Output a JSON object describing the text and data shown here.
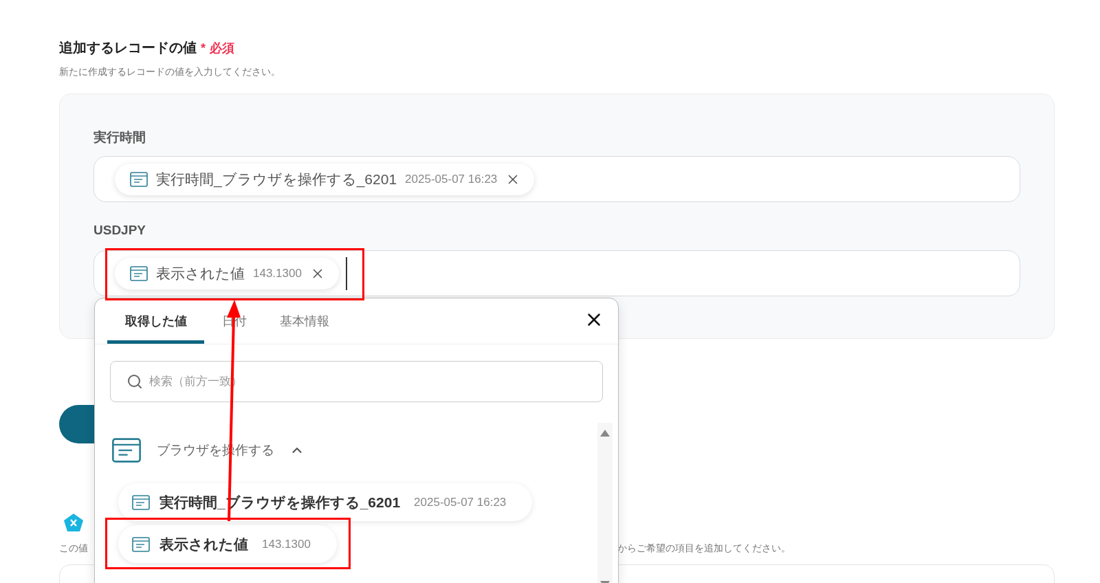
{
  "section": {
    "title": "追加するレコードの値",
    "required_mark": "*",
    "required_label": "必須",
    "description": "新たに作成するレコードの値を入力してください。"
  },
  "fields": [
    {
      "label": "実行時間",
      "chips": [
        {
          "name": "実行時間_ブラウザを操作する_6201",
          "value": "2025-05-07 16:23"
        }
      ]
    },
    {
      "label": "USDJPY",
      "chips": [
        {
          "name": "表示された値",
          "value": "143.1300"
        }
      ],
      "cursor": true
    }
  ],
  "note": {
    "start": "この値",
    "end": "からご希望の項目を追加してください。"
  },
  "popover": {
    "tabs": [
      {
        "label": "取得した値",
        "selected": true
      },
      {
        "label": "日付",
        "selected": false
      },
      {
        "label": "基本情報",
        "selected": false
      }
    ],
    "search": {
      "placeholder": "検索（前方一致）"
    },
    "group": {
      "title": "ブラウザを操作する",
      "expanded": true,
      "items": [
        {
          "name": "実行時間_ブラウザを操作する_6201",
          "value": "2025-05-07 16:23"
        },
        {
          "name": "表示された値",
          "value": "143.1300"
        }
      ]
    }
  }
}
